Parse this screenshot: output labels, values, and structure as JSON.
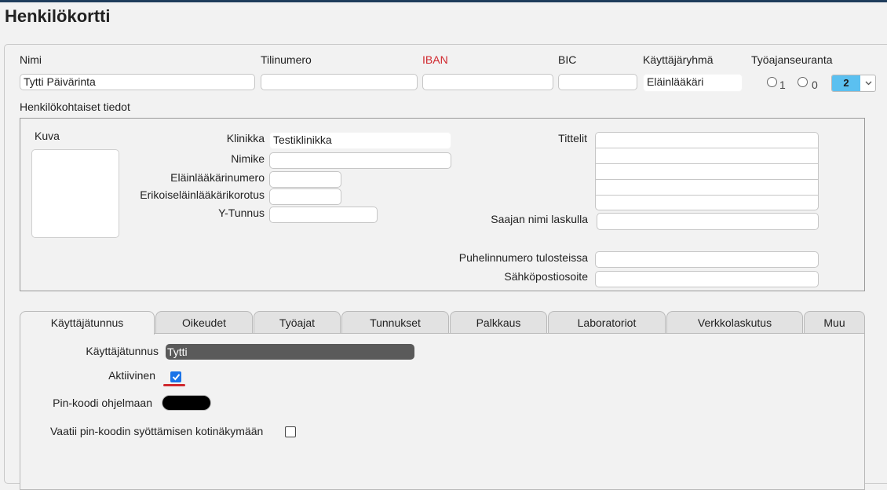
{
  "page": {
    "title": "Henkilökortti"
  },
  "header_fields": {
    "nimi": {
      "label": "Nimi",
      "value": "Tytti Päivärinta"
    },
    "tilinumero": {
      "label": "Tilinumero",
      "value": ""
    },
    "iban": {
      "label": "IBAN",
      "value": "",
      "label_color": "#d0282e"
    },
    "bic": {
      "label": "BIC",
      "value": ""
    },
    "kayttajaryhma": {
      "label": "Käyttäjäryhmä",
      "value": "Eläinlääkäri"
    },
    "tyoajanseuranta": {
      "label": "Työajanseuranta",
      "radio_options": [
        "1",
        "0"
      ],
      "spinner_value": "2"
    }
  },
  "personal": {
    "section_label": "Henkilökohtaiset tiedot",
    "photo_label": "Kuva",
    "klinikka": {
      "label": "Klinikka",
      "value": "Testiklinikka"
    },
    "nimike": {
      "label": "Nimike",
      "value": ""
    },
    "elainlaakarinumero": {
      "label": "Eläinlääkärinumero",
      "value": ""
    },
    "erikois": {
      "label": "Erikoiseläinlääkärikorotus",
      "value": ""
    },
    "ytunnus": {
      "label": "Y-Tunnus",
      "value": ""
    },
    "tittelit": {
      "label": "Tittelit",
      "rows": [
        "",
        "",
        "",
        "",
        ""
      ]
    },
    "saajan_nimi": {
      "label": "Saajan nimi laskulla",
      "value": ""
    },
    "puhelin": {
      "label": "Puhelinnumero tulosteissa",
      "value": ""
    },
    "sahkoposti": {
      "label": "Sähköpostiosoite",
      "value": ""
    }
  },
  "tabs": [
    {
      "label": "Käyttäjätunnus",
      "active": true
    },
    {
      "label": "Oikeudet",
      "active": false
    },
    {
      "label": "Työajat",
      "active": false
    },
    {
      "label": "Tunnukset",
      "active": false
    },
    {
      "label": "Palkkaus",
      "active": false
    },
    {
      "label": "Laboratoriot",
      "active": false
    },
    {
      "label": "Verkkolaskutus",
      "active": false
    },
    {
      "label": "Muu",
      "active": false
    }
  ],
  "account_tab": {
    "username": {
      "label": "Käyttäjätunnus",
      "value": "Tytti"
    },
    "aktiivinen": {
      "label": "Aktiivinen",
      "checked": true
    },
    "pin": {
      "label": "Pin-koodi ohjelmaan",
      "value": ""
    },
    "vaatii_pin": {
      "label": "Vaatii pin-koodin syöttämisen kotinäkymään",
      "checked": false
    }
  },
  "colors": {
    "accent": "#5bc0f0",
    "checkbox": "#1a73e8",
    "warning_red": "#d0282e",
    "topbar": "#1f3d5c"
  }
}
